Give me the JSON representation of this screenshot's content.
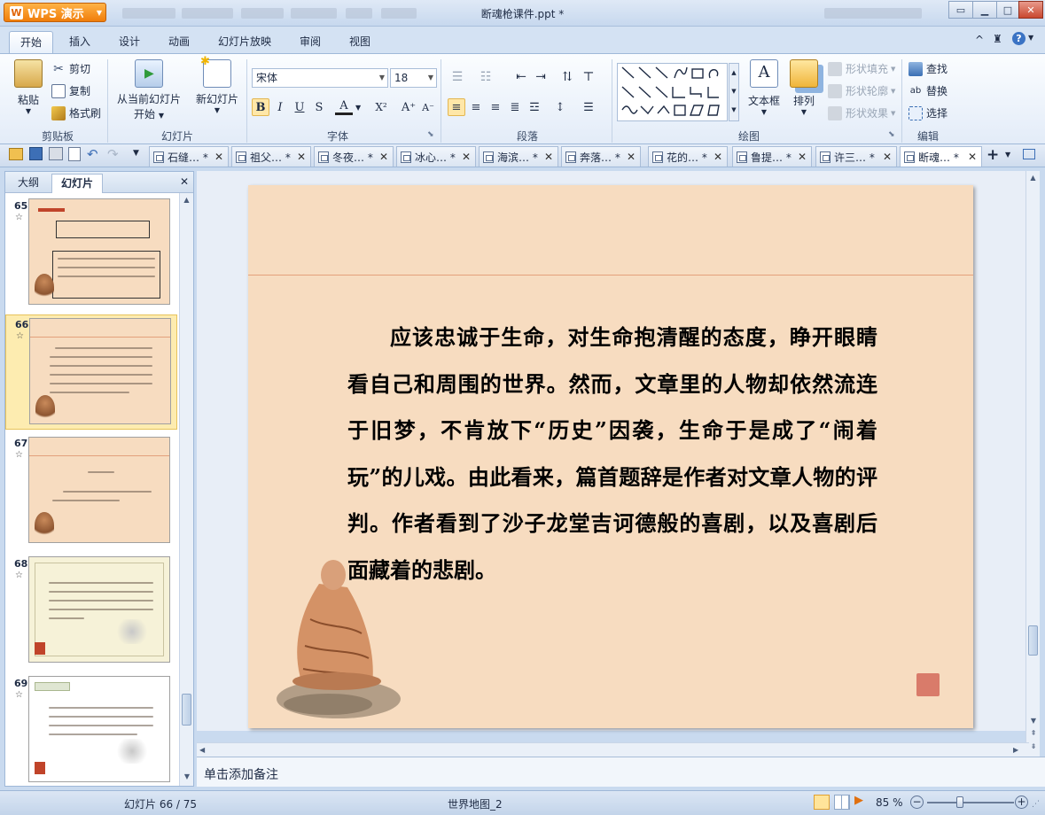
{
  "app": {
    "name": "WPS 演示",
    "doc_title": "断魂枪课件.ppt *"
  },
  "window": {
    "min": "▭",
    "max": "□",
    "close": "✕"
  },
  "ribbon_tabs": [
    "开始",
    "插入",
    "设计",
    "动画",
    "幻灯片放映",
    "审阅",
    "视图"
  ],
  "ribbon_right": {
    "collapse": "^",
    "shirt": "👕",
    "help": "?"
  },
  "clipboard": {
    "paste": "粘贴",
    "cut": "剪切",
    "copy": "复制",
    "format_painter": "格式刷",
    "label": "剪贴板"
  },
  "slides_group": {
    "from_current_1": "从当前幻灯片",
    "from_current_2": "开始",
    "new_slide": "新幻灯片",
    "label": "幻灯片"
  },
  "font_group": {
    "font_name": "宋体",
    "font_size": "18",
    "bold": "B",
    "italic": "I",
    "underline": "U",
    "shadow": "S",
    "color": "A",
    "super": "X²",
    "grow": "A⁺",
    "shrink": "A⁻",
    "label": "字体"
  },
  "paragraph_group": {
    "label": "段落"
  },
  "drawing_group": {
    "textbox": "文本框",
    "arrange": "排列",
    "shape_fill": "形状填充",
    "shape_outline": "形状轮廓",
    "shape_effect": "形状效果",
    "label": "绘图"
  },
  "edit_group": {
    "find": "查找",
    "replace": "替换",
    "select": "选择",
    "label": "编辑"
  },
  "doc_tabs": [
    {
      "label": "石缝… *"
    },
    {
      "label": "祖父… *"
    },
    {
      "label": "冬夜… *"
    },
    {
      "label": "冰心… *"
    },
    {
      "label": "海滨… *"
    },
    {
      "label": "奔落… *"
    },
    {
      "label": "花的… *"
    },
    {
      "label": "鲁提… *"
    },
    {
      "label": "许三… *"
    },
    {
      "label": "断魂… *"
    }
  ],
  "left_pane": {
    "tab_outline": "大纲",
    "tab_slides": "幻灯片",
    "close": "✕"
  },
  "thumbnails": [
    {
      "num": "65",
      "star": "☆"
    },
    {
      "num": "66",
      "star": "☆"
    },
    {
      "num": "67",
      "star": "☆"
    },
    {
      "num": "68",
      "star": "☆"
    },
    {
      "num": "69",
      "star": "☆"
    }
  ],
  "slide": {
    "text": "应该忠诚于生命，对生命抱清醒的态度，睁开眼睛看自己和周围的世界。然而，文章里的人物却依然流连于旧梦，不肯放下“历史”因袭，生命于是成了“闹着玩”的儿戏。由此看来，篇首题辞是作者对文章人物的评判。作者看到了沙子龙堂吉诃德般的喜剧，以及喜剧后面藏着的悲剧。",
    "progress": 0.88
  },
  "notes": {
    "placeholder": "单击添加备注"
  },
  "status": {
    "slide_info": "幻灯片 66 / 75",
    "template": "世界地图_2",
    "zoom": "85 %",
    "zoom_fraction": 0.38
  },
  "colors": {
    "slide_bg": "#f7dcc0",
    "accent": "#f07d0a",
    "ribbon": "#e3ecf8"
  }
}
